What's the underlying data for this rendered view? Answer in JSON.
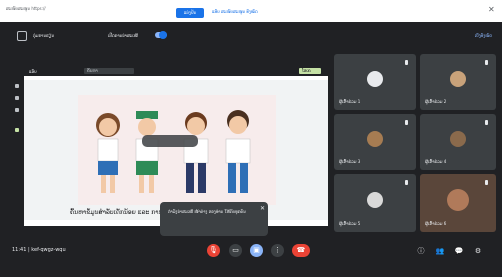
{
  "browser": {
    "url_chip": "ສະໜັບສະໜູນ https://",
    "share_label": "ແບ່ງປັນ",
    "tab_text": "ແທັບ ສະໜັບສະໜູນ ທັງໝົດ",
    "close_glyph": "✕"
  },
  "meet_header": {
    "title": "ກຸ່ມການຮຽນ",
    "toggle_label": "ເປີດການນຳສະເໜີ",
    "right_link": "ເບິ່ງທັງໝົດ"
  },
  "presentation": {
    "app_label": "ແອັບ",
    "search_placeholder": "ຄົ້ນຫາ",
    "chip_label": "ໂອເຄ",
    "caption": "ຄົ້ນຫາຂໍ້ມູນສຳລັບເດັກນ້ອຍ ແລະ ການຮຽນ (ຕົວຢ່າງ)"
  },
  "toast": {
    "text": "ກຳລັງນຳສະເໜີ ໜ້າຕ່າງ ຂອງທ່ານ ໃຫ້ກັບທຸກຄົນ",
    "close_glyph": "✕"
  },
  "participants": [
    {
      "name": "ຜູ້ເຂົ້າຮ່ວມ 1",
      "avatar_color": "#e8eaed"
    },
    {
      "name": "ຜູ້ເຂົ້າຮ່ວມ 2",
      "avatar_color": "#c8a27a"
    },
    {
      "name": "ຜູ້ເຂົ້າຮ່ວມ 3",
      "avatar_color": "#a67c52"
    },
    {
      "name": "ຜູ້ເຂົ້າຮ່ວມ 4",
      "avatar_color": "#8a6a4c"
    },
    {
      "name": "ຜູ້ເຂົ້າຮ່ວມ 5",
      "avatar_color": "#d9d9d9"
    },
    {
      "name": "ຜູ້ເຂົ້າຮ່ວມ 6",
      "avatar_color": "#b07a5a"
    }
  ],
  "bottom": {
    "meeting_info": "11:41 | kef-qwgz-wqu",
    "controls": [
      {
        "name": "mic-off-button",
        "color": "#ea4335",
        "glyph": "🎙"
      },
      {
        "name": "camera-button",
        "color": "#3c4043",
        "glyph": "▭"
      },
      {
        "name": "present-button",
        "color": "#8ab4f8",
        "glyph": "▣"
      },
      {
        "name": "more-button",
        "color": "#3c4043",
        "glyph": "⋮"
      },
      {
        "name": "end-call-button",
        "color": "#ea4335",
        "glyph": "☎"
      }
    ],
    "right_icons": [
      {
        "name": "info-icon",
        "glyph": "ⓘ"
      },
      {
        "name": "people-icon",
        "glyph": "👥"
      },
      {
        "name": "chat-icon",
        "glyph": "💬"
      },
      {
        "name": "activities-icon",
        "glyph": "⚙"
      }
    ]
  }
}
